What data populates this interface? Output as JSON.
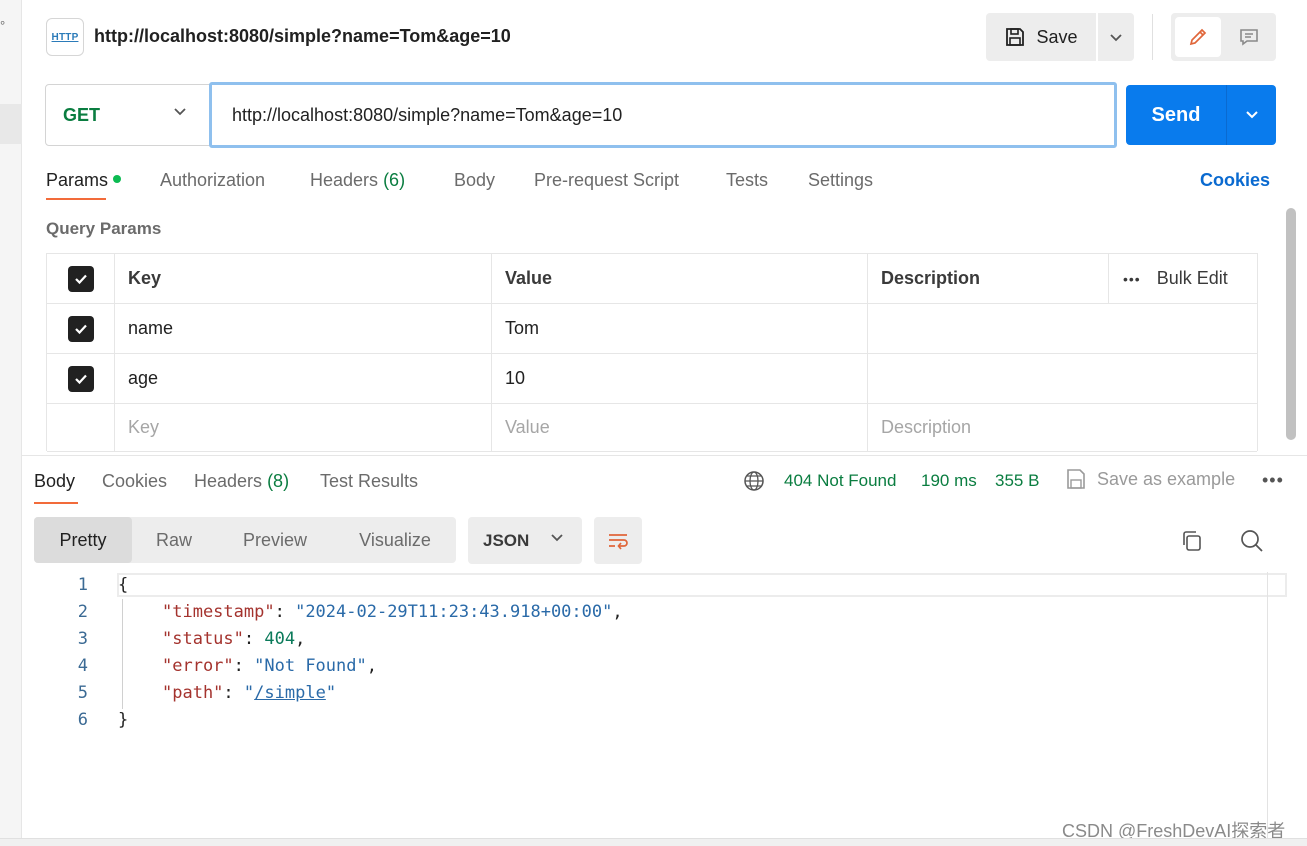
{
  "header": {
    "icon_text": "HTTP",
    "title": "http://localhost:8080/simple?name=Tom&age=10",
    "save_label": "Save"
  },
  "request": {
    "method": "GET",
    "url": "http://localhost:8080/simple?name=Tom&age=10",
    "send_label": "Send"
  },
  "req_tabs": {
    "params": "Params",
    "authorization": "Authorization",
    "headers": "Headers",
    "headers_count": "(6)",
    "body": "Body",
    "prerequest": "Pre-request Script",
    "tests": "Tests",
    "settings": "Settings",
    "cookies": "Cookies"
  },
  "query_params": {
    "title": "Query Params",
    "columns": [
      "Key",
      "Value",
      "Description"
    ],
    "bulk_edit": "Bulk Edit",
    "more": "•••",
    "rows": [
      {
        "key": "name",
        "value": "Tom",
        "description": "",
        "checked": true
      },
      {
        "key": "age",
        "value": "10",
        "description": "",
        "checked": true
      }
    ],
    "placeholders": {
      "key": "Key",
      "value": "Value",
      "description": "Description"
    }
  },
  "response": {
    "tabs": {
      "body": "Body",
      "cookies": "Cookies",
      "headers": "Headers",
      "headers_count": "(8)",
      "test_results": "Test Results"
    },
    "status": "404 Not Found",
    "time": "190 ms",
    "size": "355 B",
    "save_example": "Save as example",
    "more": "•••",
    "views": [
      "Pretty",
      "Raw",
      "Preview",
      "Visualize"
    ],
    "format": "JSON",
    "line_numbers": [
      "1",
      "2",
      "3",
      "4",
      "5",
      "6"
    ],
    "json": {
      "open": "{",
      "close": "}",
      "timestamp_key": "\"timestamp\"",
      "timestamp_val": "\"2024-02-29T11:23:43.918+00:00\"",
      "status_key": "\"status\"",
      "status_val": "404",
      "error_key": "\"error\"",
      "error_val": "\"Not Found\"",
      "path_key": "\"path\"",
      "path_val": "/simple"
    }
  },
  "watermark": "CSDN @FreshDevAI探索者",
  "colors": {
    "accent": "#f26b3a",
    "send": "#097bed",
    "success": "#0a7d40",
    "link": "#0a6ad0"
  },
  "icons": [
    "http-icon",
    "save-icon",
    "chevron-down-icon",
    "pencil-icon",
    "comment-icon",
    "checkbox-icon",
    "globe-icon",
    "save-example-icon",
    "wrap-lines-icon",
    "copy-icon",
    "search-icon"
  ]
}
